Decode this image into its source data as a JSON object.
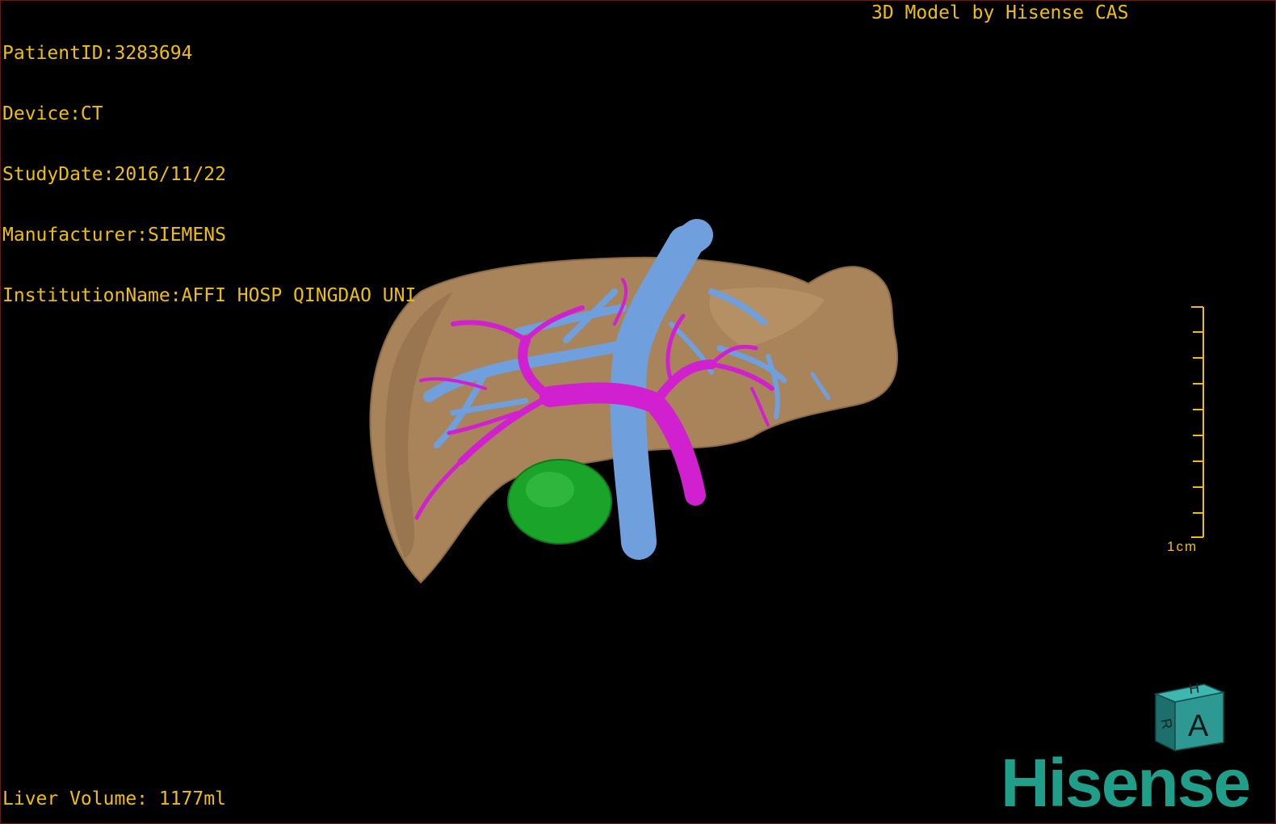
{
  "patient_info": {
    "patient_id": "PatientID:3283694",
    "device": "Device:CT",
    "study_date": "StudyDate:2016/11/22",
    "manufacturer": "Manufacturer:SIEMENS",
    "institution": "InstitutionName:AFFI HOSP QINGDAO UNI"
  },
  "model_credit": "3D Model by Hisense CAS",
  "liver_volume": "Liver Volume: 1177ml",
  "scale_bar": {
    "label": "1cm",
    "ticks": 10
  },
  "orientation_cube": {
    "faces": [
      "H",
      "A",
      "R"
    ]
  },
  "brand": {
    "name": "Hisense",
    "color": "#1f9e8a"
  },
  "colors": {
    "text": "#f0c000",
    "liver": "#a9845a",
    "hepatic_vein": "#6f9fdc",
    "portal_vein": "#d020d0",
    "gallbladder": "#1aa52a"
  }
}
